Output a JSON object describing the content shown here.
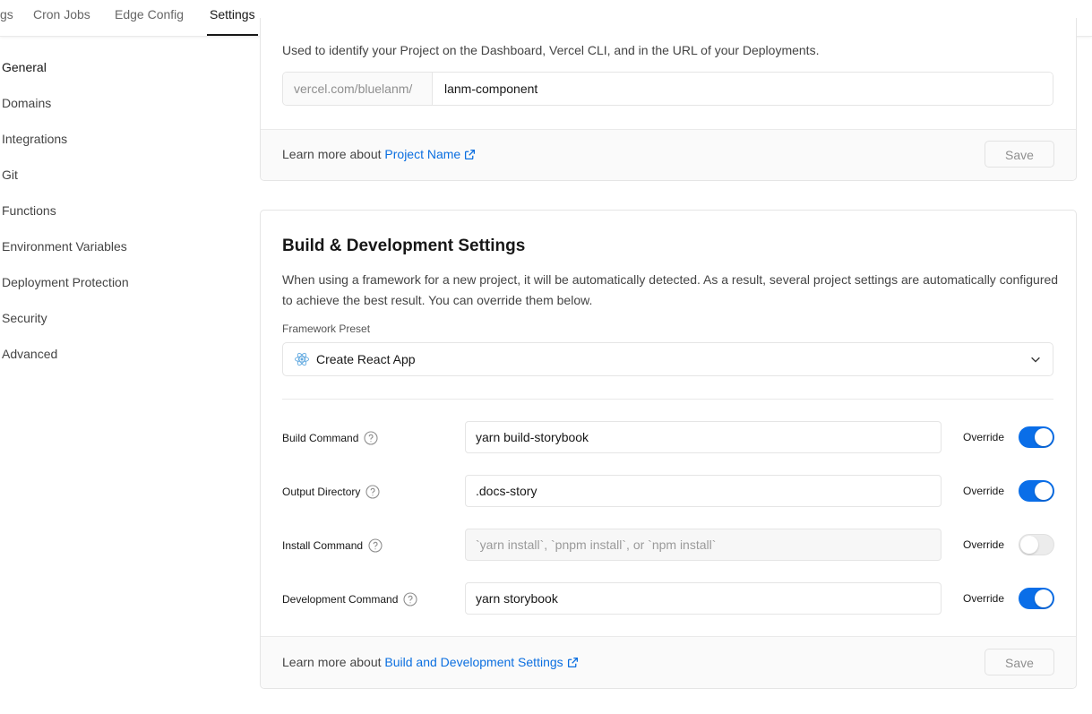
{
  "tabs": [
    {
      "label": "gs"
    },
    {
      "label": "Cron Jobs"
    },
    {
      "label": "Edge Config"
    },
    {
      "label": "Settings",
      "active": true
    }
  ],
  "sidebar": {
    "items": [
      {
        "label": "General",
        "active": true
      },
      {
        "label": "Domains"
      },
      {
        "label": "Integrations"
      },
      {
        "label": "Git"
      },
      {
        "label": "Functions"
      },
      {
        "label": "Environment Variables"
      },
      {
        "label": "Deployment Protection"
      },
      {
        "label": "Security"
      },
      {
        "label": "Advanced"
      }
    ]
  },
  "project_name_card": {
    "description": "Used to identify your Project on the Dashboard, Vercel CLI, and in the URL of your Deployments.",
    "url_prefix": "vercel.com/bluelanm/",
    "project_name_value": "lanm-component",
    "footer_text": "Learn more about ",
    "footer_link": "Project Name",
    "save_label": "Save"
  },
  "build_card": {
    "title": "Build & Development Settings",
    "description": "When using a framework for a new project, it will be automatically detected. As a result, several project settings are automatically configured to achieve the best result. You can override them below.",
    "framework_label": "Framework Preset",
    "framework_value": "Create React App",
    "framework_icon": "react-icon",
    "fields": [
      {
        "label": "Build Command",
        "value": "yarn build-storybook",
        "placeholder": "",
        "override_label": "Override",
        "override": true
      },
      {
        "label": "Output Directory",
        "value": ".docs-story",
        "placeholder": "",
        "override_label": "Override",
        "override": true
      },
      {
        "label": "Install Command",
        "value": "",
        "placeholder": "`yarn install`, `pnpm install`, or `npm install`",
        "override_label": "Override",
        "override": false
      },
      {
        "label": "Development Command",
        "value": "yarn storybook",
        "placeholder": "",
        "override_label": "Override",
        "override": true
      }
    ],
    "footer_text": "Learn more about ",
    "footer_link": "Build and Development Settings",
    "save_label": "Save"
  },
  "colors": {
    "accent": "#0a6ee8",
    "link": "#0b6fe0",
    "border": "#e5e5e5",
    "footer_bg": "#fafafa"
  }
}
